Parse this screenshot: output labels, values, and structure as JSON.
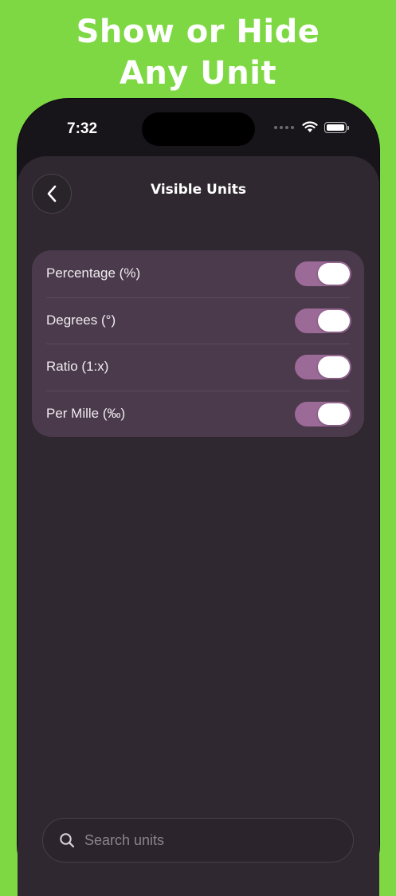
{
  "banner": {
    "line1": "Show or Hide",
    "line2": "Any Unit"
  },
  "status_bar": {
    "time": "7:32",
    "icons": [
      "cellular-dots-icon",
      "wifi-icon",
      "battery-icon"
    ]
  },
  "header": {
    "title": "Visible Units",
    "back_icon": "chevron-left-icon"
  },
  "units": [
    {
      "label": "Percentage (%)",
      "enabled": true
    },
    {
      "label": "Degrees (°)",
      "enabled": true
    },
    {
      "label": "Ratio (1:x)",
      "enabled": true
    },
    {
      "label": "Per Mille (‰)",
      "enabled": true
    }
  ],
  "search": {
    "placeholder": "Search units",
    "value": "",
    "icon": "search-icon"
  },
  "colors": {
    "background": "#7ed844",
    "sheet": "#2f2830",
    "card": "#4b3a4b",
    "toggle_on": "#9b6a97"
  }
}
